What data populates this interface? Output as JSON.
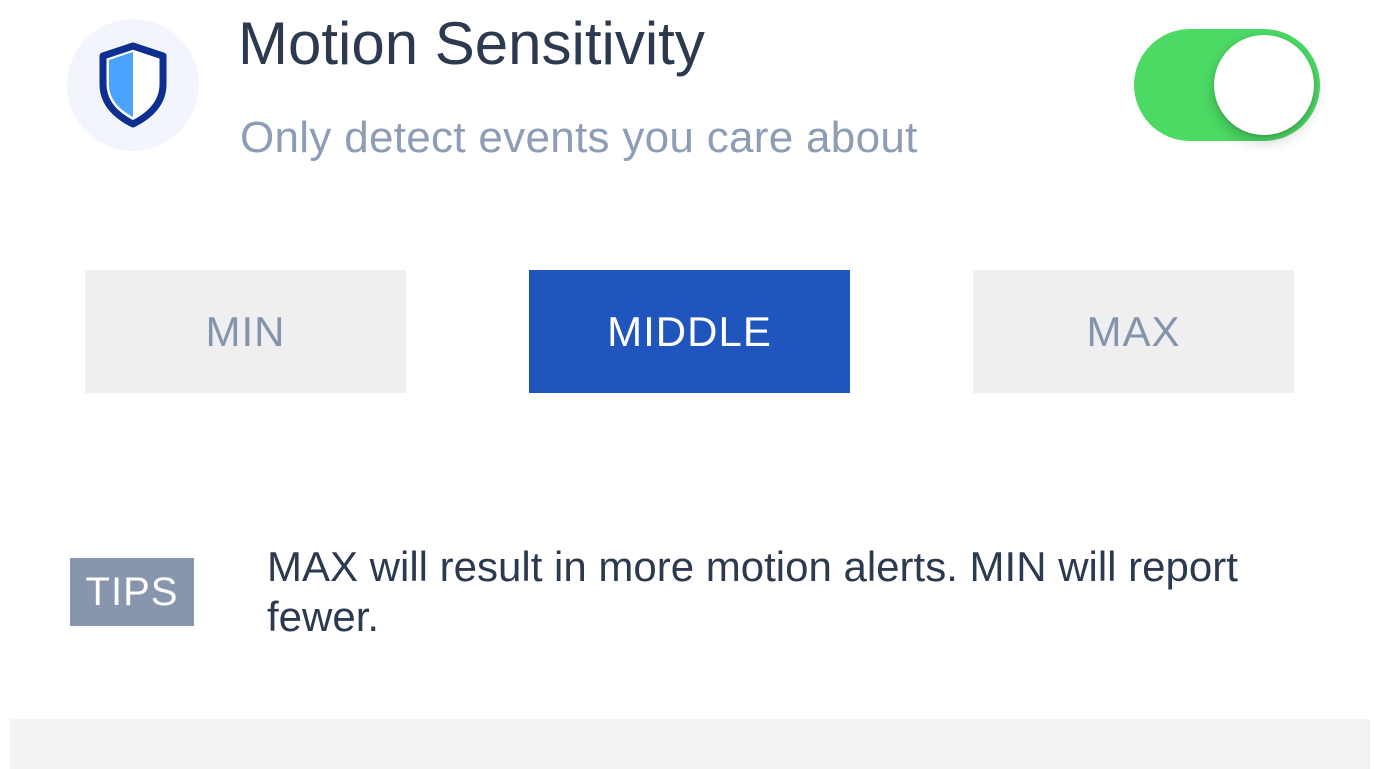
{
  "setting": {
    "title": "Motion Sensitivity",
    "subtitle": "Only detect events you care about",
    "icon": "shield-icon",
    "enabled": true
  },
  "sensitivity": {
    "options": [
      "MIN",
      "MIDDLE",
      "MAX"
    ],
    "selected": "MIDDLE"
  },
  "tips": {
    "badge": "TIPS",
    "text": "MAX will result in more motion alerts. MIN will report fewer."
  },
  "colors": {
    "toggle_on": "#4cd964",
    "selected_button": "#2055bd",
    "unselected_button": "#efefef",
    "title": "#2c3a4f",
    "subtitle": "#8d9db5",
    "tips_badge": "#8796ad",
    "shield_dark": "#0d2f8f",
    "shield_light": "#4aa3ff"
  }
}
